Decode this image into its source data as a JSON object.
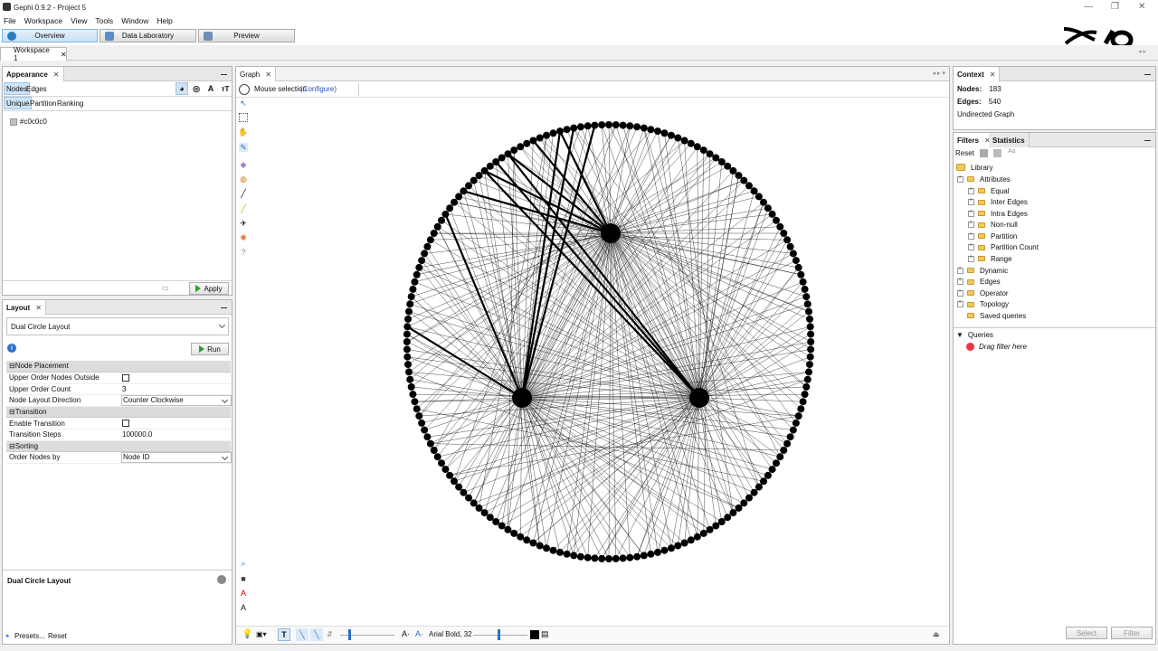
{
  "window": {
    "title": "Gephi 0.9.2 - Project 5"
  },
  "menu": [
    "File",
    "Workspace",
    "View",
    "Tools",
    "Window",
    "Help"
  ],
  "modes": [
    {
      "label": "Overview",
      "active": true
    },
    {
      "label": "Data Laboratory",
      "active": false
    },
    {
      "label": "Preview",
      "active": false
    }
  ],
  "workspace_tab": "Workspace 1",
  "appearance": {
    "tab": "Appearance",
    "subtabs": [
      "Nodes",
      "Edges"
    ],
    "modes": [
      "Unique",
      "Partition",
      "Ranking"
    ],
    "color_value": "#c0c0c0",
    "apply": "Apply"
  },
  "layout": {
    "tab": "Layout",
    "selected": "Dual Circle Layout",
    "run": "Run",
    "sections": {
      "placement": "Node Placement",
      "transition": "Transition",
      "sorting": "Sorting"
    },
    "props": {
      "upper_outside": "Upper Order Nodes Outside",
      "upper_count_label": "Upper Order Count",
      "upper_count": "3",
      "direction_label": "Node Layout Direction",
      "direction": "Counter Clockwise",
      "enable_transition": "Enable Transition",
      "steps_label": "Transition Steps",
      "steps": "100000.0",
      "order_label": "Order Nodes by",
      "order": "Node ID"
    },
    "description_title": "Dual Circle Layout",
    "presets": "Presets...",
    "reset": "Reset"
  },
  "graph": {
    "tab": "Graph",
    "mode": "Mouse selection",
    "configure": "(Configure)",
    "font_label": "Arial Bold, 32"
  },
  "context": {
    "tab": "Context",
    "nodes_label": "Nodes:",
    "nodes": "183",
    "edges_label": "Edges:",
    "edges": "540",
    "type": "Undirected Graph"
  },
  "filters": {
    "tabs": [
      "Filters",
      "Statistics"
    ],
    "reset": "Reset",
    "library": "Library",
    "attributes": "Attributes",
    "attribute_items": [
      "Equal",
      "Inter Edges",
      "Intra Edges",
      "Non-null",
      "Partition",
      "Partition Count",
      "Range"
    ],
    "groups": [
      "Dynamic",
      "Edges",
      "Operator",
      "Topology",
      "Saved queries"
    ],
    "queries": "Queries",
    "drag_hint": "Drag filter here",
    "select": "Select",
    "filter": "Filter"
  },
  "colors": {
    "accent": "#cfe3f7",
    "apply_green": "#2e9b2e",
    "node_fill": "#c0c0c0"
  }
}
